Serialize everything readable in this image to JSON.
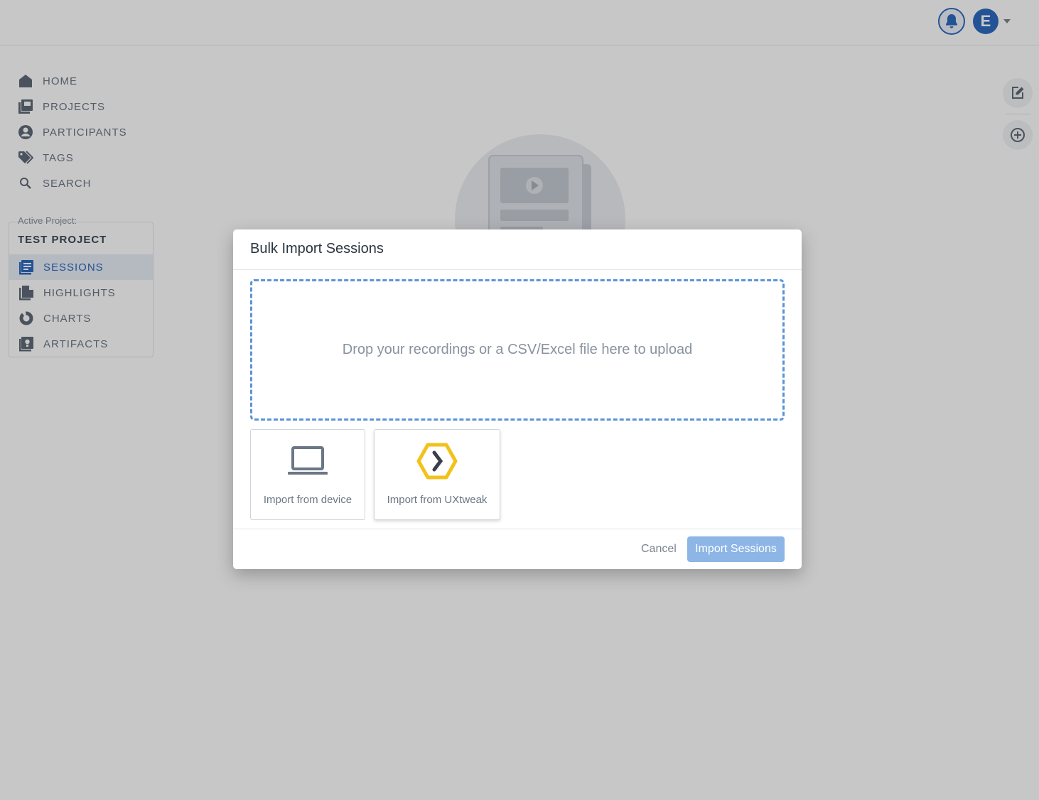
{
  "topbar": {
    "avatar_initial": "E",
    "bell_icon": "bell-icon",
    "caret_icon": "caret-down-icon"
  },
  "nav": {
    "items": [
      {
        "label": "HOME",
        "icon": "home-icon"
      },
      {
        "label": "PROJECTS",
        "icon": "projects-icon"
      },
      {
        "label": "PARTICIPANTS",
        "icon": "participant-icon"
      },
      {
        "label": "TAGS",
        "icon": "tag-icon"
      },
      {
        "label": "SEARCH",
        "icon": "search-icon"
      }
    ]
  },
  "project": {
    "active_label": "Active Project:",
    "name": "TEST PROJECT",
    "items": [
      {
        "label": "SESSIONS",
        "icon": "sessions-icon",
        "active": true
      },
      {
        "label": "HIGHLIGHTS",
        "icon": "highlights-icon",
        "active": false
      },
      {
        "label": "CHARTS",
        "icon": "charts-icon",
        "active": false
      },
      {
        "label": "ARTIFACTS",
        "icon": "artifacts-icon",
        "active": false
      }
    ]
  },
  "rail": {
    "edit_icon": "edit-icon",
    "add_icon": "add-circle-icon"
  },
  "modal": {
    "title": "Bulk Import Sessions",
    "dropzone_text": "Drop your recordings or a CSV/Excel file here to upload",
    "options": [
      {
        "label": "Import from device",
        "icon": "laptop-icon"
      },
      {
        "label": "Import from UXtweak",
        "icon": "uxtweak-logo-icon"
      }
    ],
    "cancel_label": "Cancel",
    "submit_label": "Import Sessions"
  },
  "colors": {
    "accent": "#2d6bbf",
    "submit_disabled": "#8db5e6",
    "dropzone_border": "#5b93d6",
    "uxtweak_yellow": "#f2c21b"
  }
}
